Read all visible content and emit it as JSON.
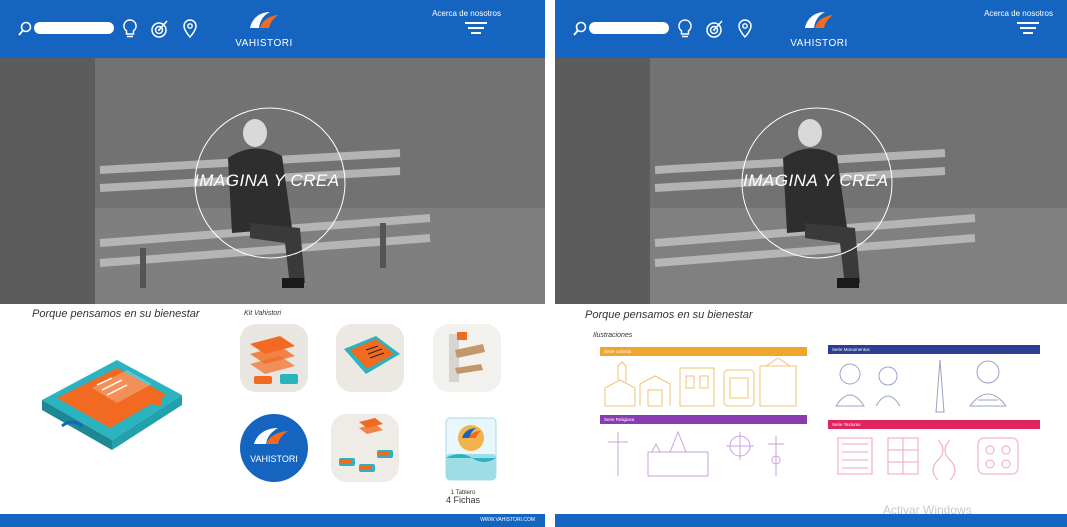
{
  "panels": [
    {
      "header": {
        "logo_text": "VAHISTORI",
        "about_label": "Acerca de nosotros"
      },
      "hero": {
        "tagline": "IMAGINA Y CREA"
      },
      "section_title": "Porque pensamos en su bienestar",
      "kit_title": "Kit Vahistori",
      "tile_logo_text": "VAHISTORI",
      "fichas": {
        "line1": "1 Tablero",
        "line2": "4 Fichas"
      },
      "footer": {
        "url": "WWW.VAHISTORI.COM"
      }
    },
    {
      "header": {
        "logo_text": "VAHISTORI",
        "about_label": "Acerca de nosotros"
      },
      "hero": {
        "tagline": "IMAGINA Y CREA"
      },
      "section_title": "Porque pensamos en su bienestar",
      "illustrations_title": "Ilustraciones",
      "series": [
        {
          "label": "Serie colonial",
          "color": "#f0a52c"
        },
        {
          "label": "Serie Monumentos",
          "color": "#2c3e93"
        },
        {
          "label": "Serie Religiosa",
          "color": "#8a3bb0"
        },
        {
          "label": "Serie Texturas",
          "color": "#e0245e"
        }
      ],
      "watermark": "Activar Windows"
    }
  ],
  "colors": {
    "brand_blue": "#1565c0",
    "accent_orange": "#f26a21",
    "accent_teal": "#2bb3c0"
  },
  "icons": [
    "search-icon",
    "lightbulb-icon",
    "target-icon",
    "location-pin-icon",
    "menu-icon"
  ]
}
